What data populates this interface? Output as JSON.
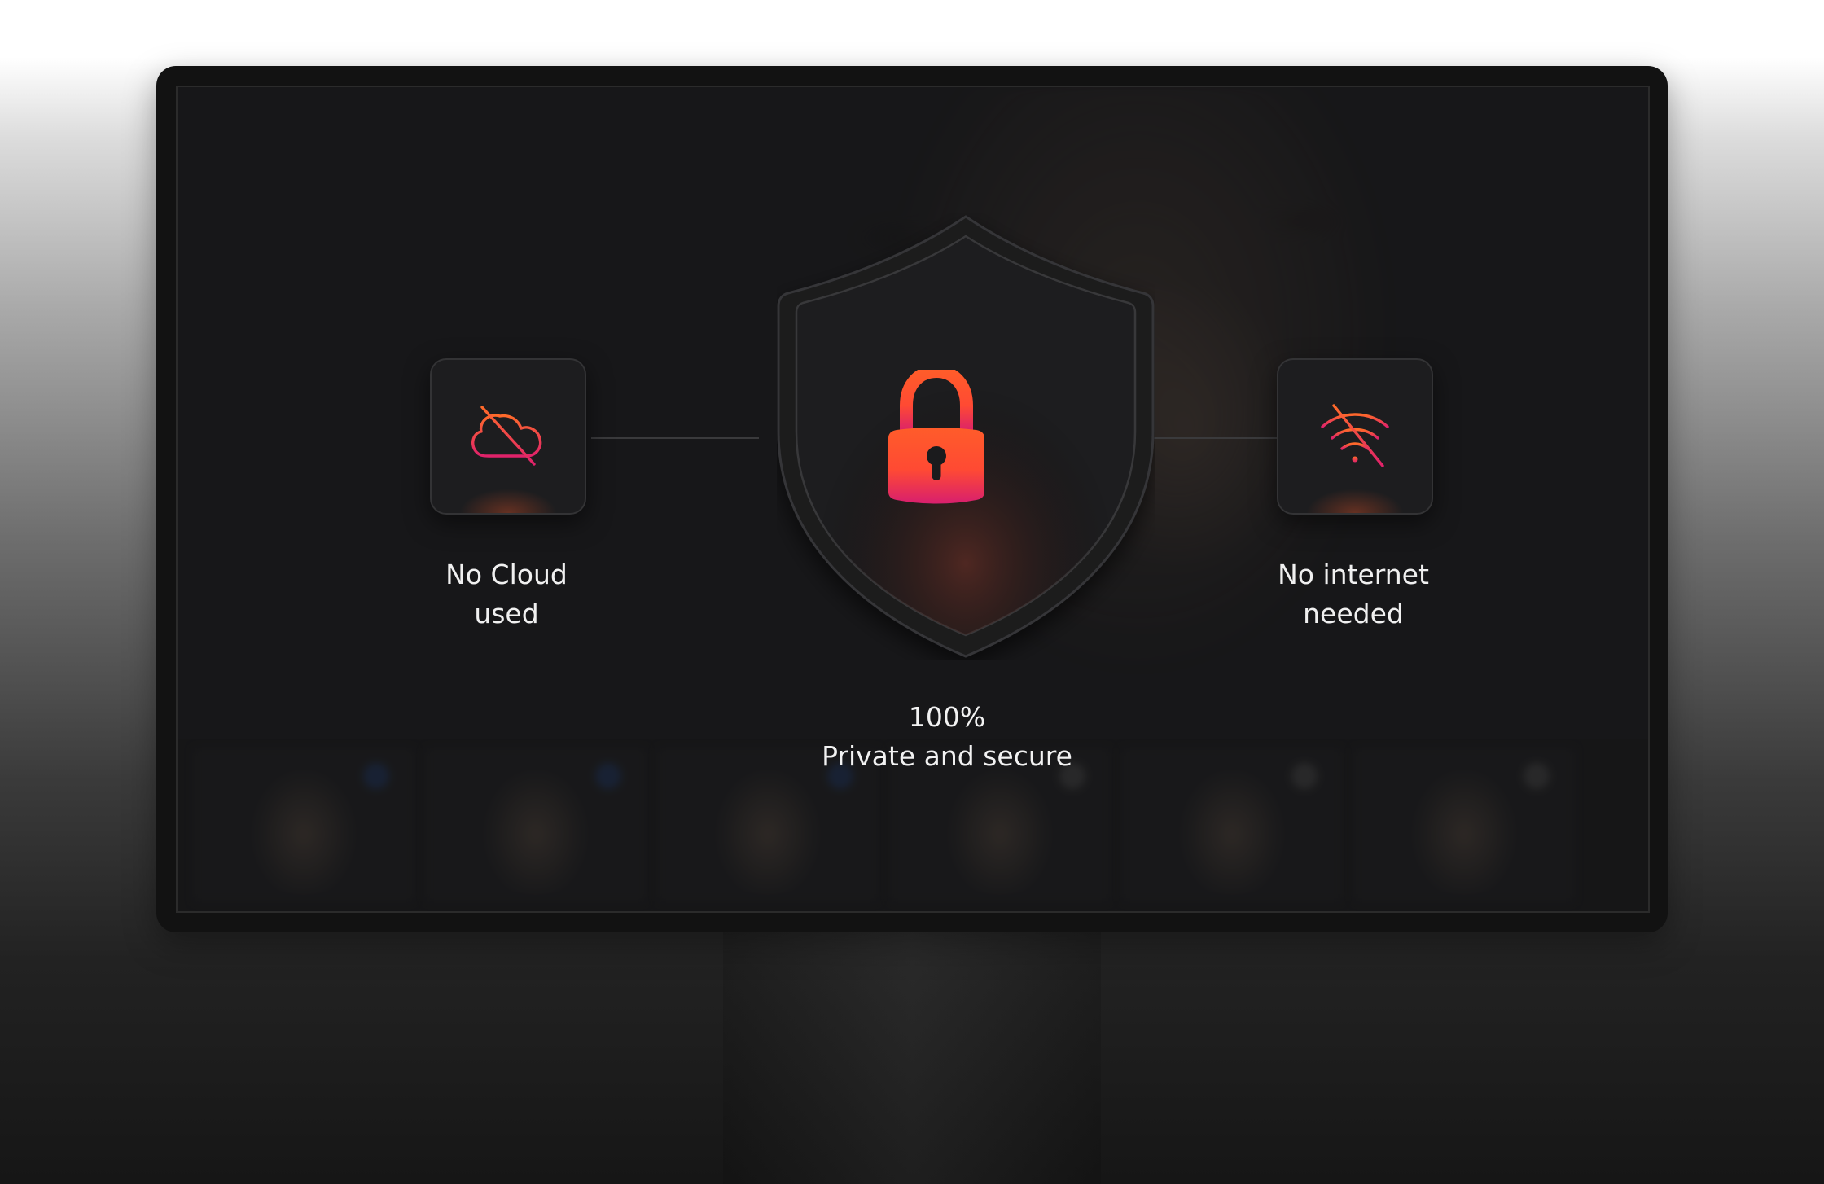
{
  "colors": {
    "accent_orange": "#ff5a2e",
    "accent_pink": "#e0226a",
    "screen_bg": "#1b1b1c",
    "frame": "#121212"
  },
  "features": {
    "no_cloud": {
      "icon": "cloud-off-icon",
      "label": "No Cloud\nused"
    },
    "no_internet": {
      "icon": "wifi-off-icon",
      "label": "No internet\nneeded"
    }
  },
  "center": {
    "icon": "lock-icon",
    "shield_icon": "shield-icon",
    "percent": "100%",
    "caption": "Private and secure"
  }
}
